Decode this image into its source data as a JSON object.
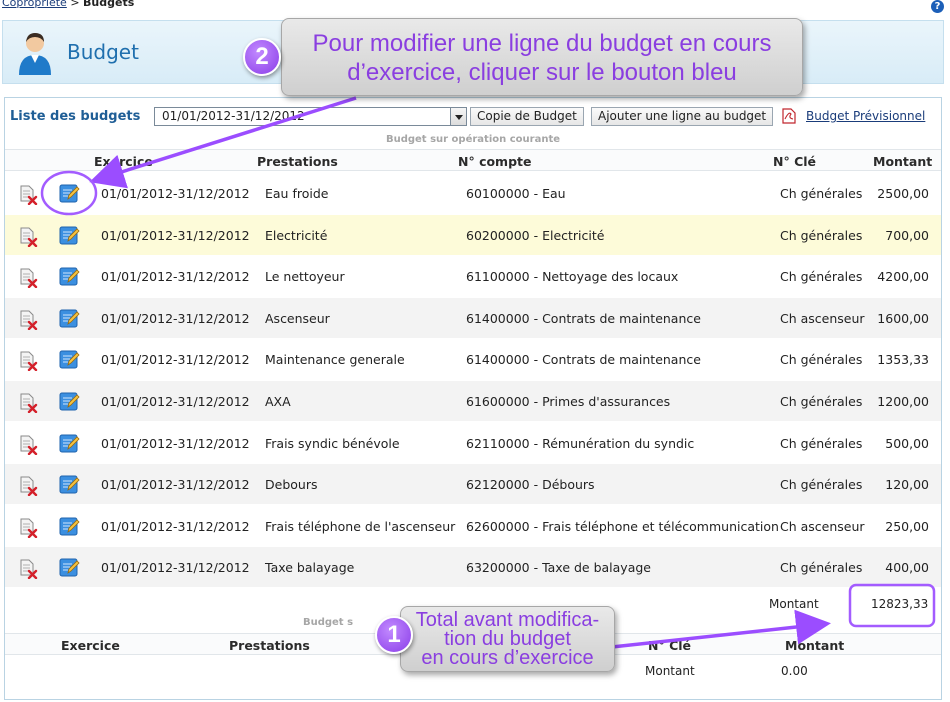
{
  "breadcrumb": {
    "parent": "Copropriété",
    "separator": " > ",
    "current": "Budgets"
  },
  "help": {
    "label": "?"
  },
  "header": {
    "title": "Budget"
  },
  "toolbar": {
    "list_label": "Liste des budgets",
    "selected_period": "01/01/2012-31/12/2012",
    "copy_button": "Copie de Budget",
    "add_line_button": "Ajouter une ligne au budget",
    "forecast_link": "Budget Prévisionnel"
  },
  "section_current": {
    "title": "Budget sur opération courante",
    "columns": {
      "exercice": "Exercice",
      "prestations": "Prestations",
      "compte": "N° compte",
      "cle": "N° Clé",
      "montant": "Montant"
    },
    "rows": [
      {
        "exercice": "01/01/2012-31/12/2012",
        "prestation": "Eau froide",
        "compte": "60100000 - Eau",
        "cle": "Ch générales",
        "montant": "2500,00"
      },
      {
        "exercice": "01/01/2012-31/12/2012",
        "prestation": "Electricité",
        "compte": "60200000 - Electricité",
        "cle": "Ch générales",
        "montant": "700,00"
      },
      {
        "exercice": "01/01/2012-31/12/2012",
        "prestation": "Le nettoyeur",
        "compte": "61100000 - Nettoyage des locaux",
        "cle": "Ch générales",
        "montant": "4200,00"
      },
      {
        "exercice": "01/01/2012-31/12/2012",
        "prestation": "Ascenseur",
        "compte": "61400000 - Contrats de maintenance",
        "cle": "Ch ascenseur",
        "montant": "1600,00"
      },
      {
        "exercice": "01/01/2012-31/12/2012",
        "prestation": "Maintenance generale",
        "compte": "61400000 - Contrats de maintenance",
        "cle": "Ch générales",
        "montant": "1353,33"
      },
      {
        "exercice": "01/01/2012-31/12/2012",
        "prestation": "AXA",
        "compte": "61600000 - Primes d'assurances",
        "cle": "Ch générales",
        "montant": "1200,00"
      },
      {
        "exercice": "01/01/2012-31/12/2012",
        "prestation": "Frais syndic bénévole",
        "compte": "62110000 - Rémunération du syndic",
        "cle": "Ch générales",
        "montant": "500,00"
      },
      {
        "exercice": "01/01/2012-31/12/2012",
        "prestation": "Debours",
        "compte": "62120000 - Débours",
        "cle": "Ch générales",
        "montant": "120,00"
      },
      {
        "exercice": "01/01/2012-31/12/2012",
        "prestation": "Frais téléphone de l'ascenseur",
        "compte": "62600000 - Frais téléphone et télécommunication",
        "cle": "Ch ascenseur",
        "montant": "250,00"
      },
      {
        "exercice": "01/01/2012-31/12/2012",
        "prestation": "Taxe balayage",
        "compte": "63200000 - Taxe de balayage",
        "cle": "Ch générales",
        "montant": "400,00"
      }
    ],
    "total_label": "Montant",
    "total_value": "12823,33"
  },
  "section_exceptional": {
    "title_visible": "Budget s",
    "columns": {
      "exercice": "Exercice",
      "prestations": "Prestations",
      "cle": "N° Clé",
      "montant": "Montant"
    },
    "total_label": "Montant",
    "total_value": "0.00"
  },
  "annotations": {
    "callout_2": {
      "badge": "2",
      "line1": "Pour modifier une ligne du budget en cours",
      "line2": "d’exercice, cliquer sur le bouton bleu"
    },
    "callout_1": {
      "badge": "1",
      "line1": "Total avant modifica-",
      "line2": "tion du budget",
      "line3": "en cours d’exercice"
    }
  },
  "colors": {
    "accent": "#1f6fae",
    "highlight_row": "#fdfbd9",
    "annotation": "#9b4dff"
  },
  "icons": {
    "delete": "delete-document-icon",
    "edit": "edit-pencil-icon",
    "pdf": "pdf-icon",
    "avatar": "user-avatar-icon",
    "help": "help-icon"
  }
}
